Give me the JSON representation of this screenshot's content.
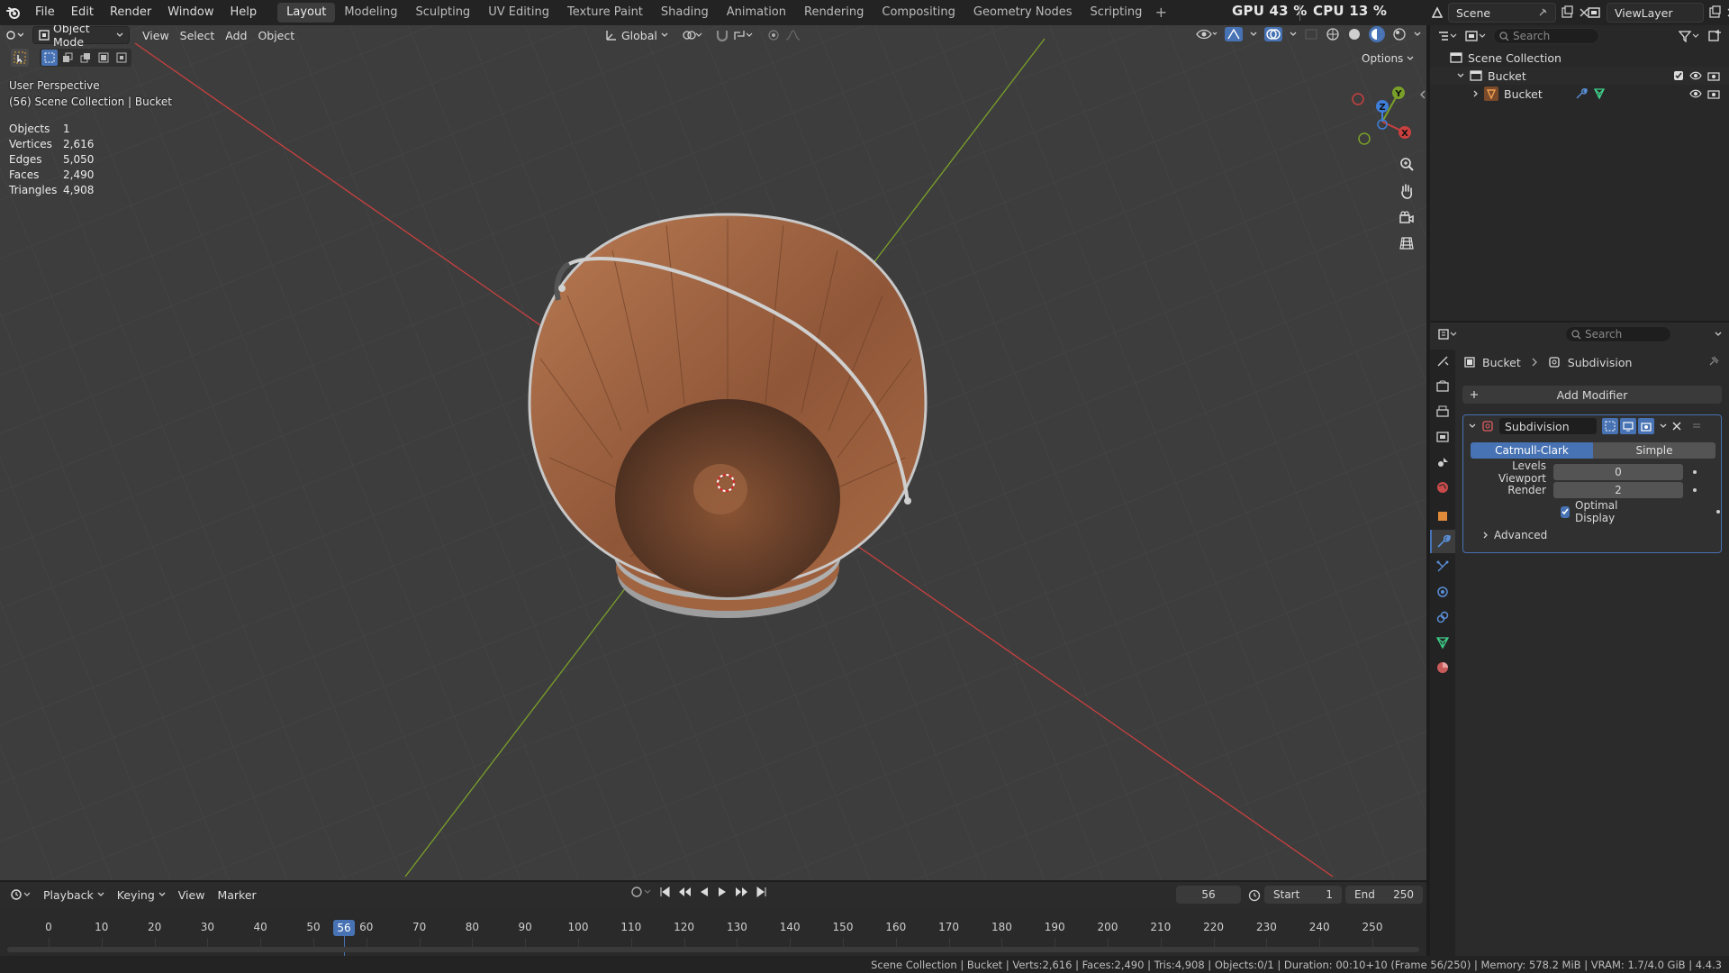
{
  "topbar": {
    "menus": [
      "File",
      "Edit",
      "Render",
      "Window",
      "Help"
    ],
    "workspaces": [
      "Layout",
      "Modeling",
      "Sculpting",
      "UV Editing",
      "Texture Paint",
      "Shading",
      "Animation",
      "Rendering",
      "Compositing",
      "Geometry Nodes",
      "Scripting"
    ],
    "active_workspace": "Layout",
    "gpu_label": "GPU",
    "gpu_value": "43 %",
    "cpu_label": "CPU",
    "cpu_value": "13 %",
    "scene_name": "Scene",
    "view_layer": "ViewLayer"
  },
  "viewport": {
    "mode": "Object Mode",
    "menus": [
      "View",
      "Select",
      "Add",
      "Object"
    ],
    "transform_orientation": "Global",
    "options_label": "Options",
    "perspective_label": "User Perspective",
    "collection_label": "(56) Scene Collection | Bucket",
    "stats": [
      {
        "label": "Objects",
        "value": "1"
      },
      {
        "label": "Vertices",
        "value": "2,616"
      },
      {
        "label": "Edges",
        "value": "5,050"
      },
      {
        "label": "Faces",
        "value": "2,490"
      },
      {
        "label": "Triangles",
        "value": "4,908"
      }
    ],
    "gizmo_axes": {
      "x": "X",
      "y": "Y",
      "z": "Z"
    }
  },
  "outliner": {
    "search_placeholder": "Search",
    "root": "Scene Collection",
    "collection": "Bucket",
    "object": "Bucket"
  },
  "properties": {
    "search_placeholder": "Search",
    "breadcrumb_object": "Bucket",
    "breadcrumb_modifier": "Subdivision",
    "add_modifier_label": "Add Modifier",
    "modifier_name": "Subdivision",
    "algo_options": [
      "Catmull-Clark",
      "Simple"
    ],
    "algo_selected": "Catmull-Clark",
    "levels_viewport_label": "Levels Viewport",
    "levels_viewport_value": "0",
    "render_label": "Render",
    "render_value": "2",
    "optimal_display_label": "Optimal Display",
    "optimal_display_checked": true,
    "advanced_label": "Advanced"
  },
  "timeline": {
    "menus": [
      "Playback",
      "Keying",
      "View",
      "Marker"
    ],
    "current_frame": "56",
    "start_label": "Start",
    "start_value": "1",
    "end_label": "End",
    "end_value": "250",
    "ticks": [
      "0",
      "10",
      "20",
      "30",
      "40",
      "50",
      "60",
      "70",
      "80",
      "90",
      "100",
      "110",
      "120",
      "130",
      "140",
      "150",
      "160",
      "170",
      "180",
      "190",
      "200",
      "210",
      "220",
      "230",
      "240",
      "250"
    ]
  },
  "statusbar": {
    "text": "Scene Collection | Bucket | Verts:2,616 | Faces:2,490 | Tris:4,908 | Objects:0/1 | Duration: 00:10+10 (Frame 56/250) | Memory: 578.2 MiB | VRAM: 1.7/4.0 GiB | 4.4.3"
  },
  "colors": {
    "accent": "#4772b3",
    "viewport_bg": "#3d3d3d",
    "x_axis": "#c9403f",
    "y_axis": "#7aa02a",
    "z_axis": "#3f7fd9",
    "wood": "#a86a44"
  }
}
